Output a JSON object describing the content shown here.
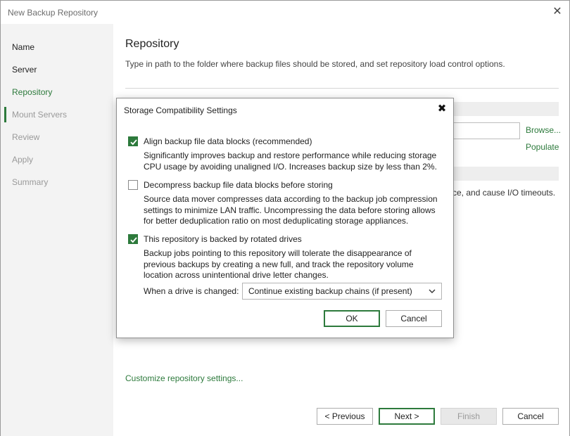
{
  "window": {
    "title": "New Backup Repository",
    "close_glyph": "✕"
  },
  "sidebar": {
    "items": [
      {
        "label": "Name",
        "state": "done"
      },
      {
        "label": "Server",
        "state": "done"
      },
      {
        "label": "Repository",
        "state": "active"
      },
      {
        "label": "Mount Servers",
        "state": "disabled"
      },
      {
        "label": "Review",
        "state": "disabled"
      },
      {
        "label": "Apply",
        "state": "disabled"
      },
      {
        "label": "Summary",
        "state": "disabled"
      }
    ]
  },
  "main": {
    "title": "Repository",
    "description": "Type in path to the folder where backup files should be stored, and set repository load control options.",
    "browse_link": "Browse...",
    "populate_link": "Populate",
    "background_text": "ce, and cause I/O timeouts.",
    "customize_link": "Customize repository settings..."
  },
  "footer": {
    "previous": "< Previous",
    "next": "Next >",
    "finish": "Finish",
    "cancel": "Cancel"
  },
  "dialog": {
    "title": "Storage Compatibility Settings",
    "close_glyph": "✖",
    "options": [
      {
        "label": "Align backup file data blocks (recommended)",
        "checked": true,
        "description": "Significantly improves backup and restore performance while reducing storage CPU usage by avoiding unaligned I/O. Increases backup size by less than 2%."
      },
      {
        "label": "Decompress backup file data blocks before storing",
        "checked": false,
        "description": "Source data mover compresses data according to the backup job compression settings to minimize LAN traffic. Uncompressing the data before storing allows for better deduplication ratio on most deduplicating storage appliances."
      },
      {
        "label": "This repository is backed by rotated drives",
        "checked": true,
        "description": "Backup jobs pointing to this repository will tolerate the disappearance of previous backups by creating a new full, and track the repository volume location across unintentional drive letter changes."
      }
    ],
    "drive_changed_label": "When a drive is changed:",
    "drive_changed_value": "Continue existing backup chains (if present)",
    "ok": "OK",
    "cancel": "Cancel"
  },
  "colors": {
    "accent": "#2d7a3c",
    "sidebar_bg": "#f3f3f3",
    "disabled_text": "#9a9a9a"
  }
}
